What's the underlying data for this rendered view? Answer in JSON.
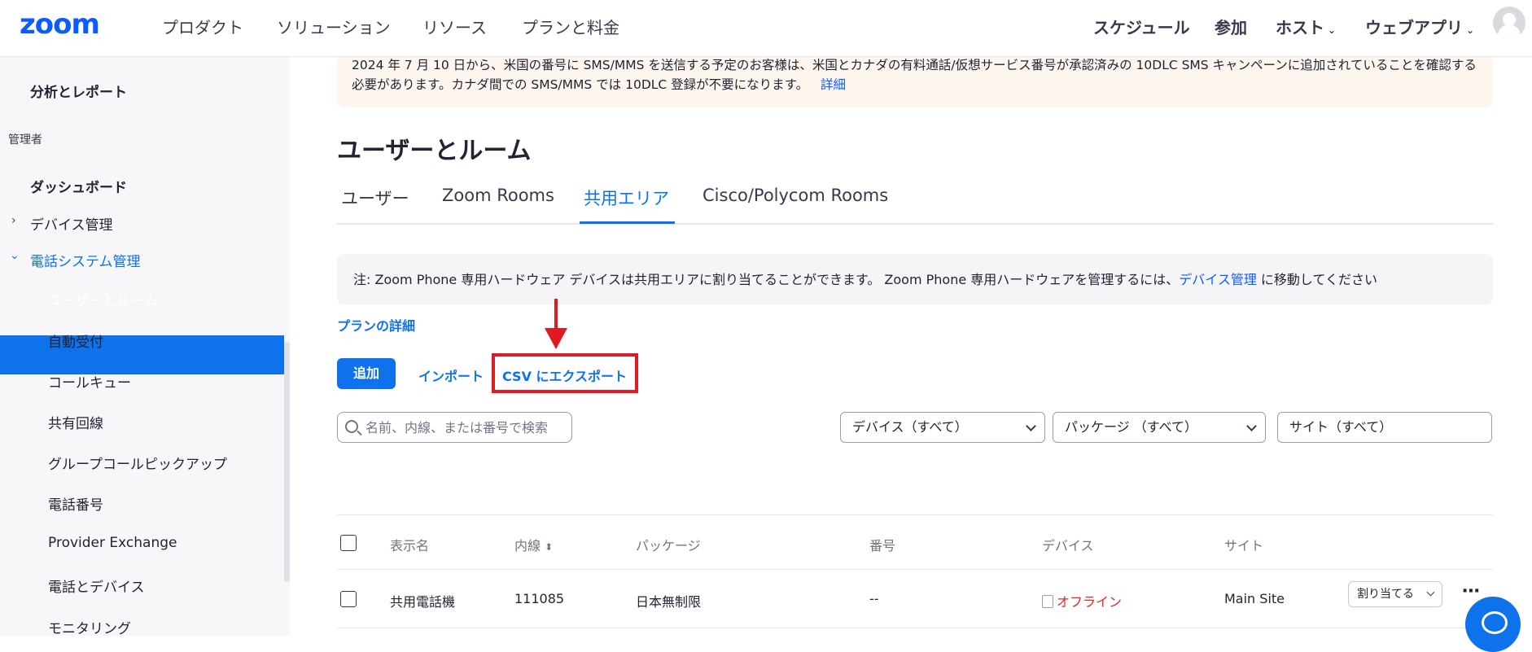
{
  "header": {
    "logo": "zoom",
    "nav": [
      "プロダクト",
      "ソリューション",
      "リソース",
      "プランと料金"
    ],
    "right_nav": [
      "スケジュール",
      "参加",
      "ホスト",
      "ウェブアプリ"
    ]
  },
  "sidebar": {
    "items": [
      {
        "label": "分析とレポート"
      },
      {
        "label": "管理者"
      },
      {
        "label": "ダッシュボード"
      },
      {
        "label": "デバイス管理",
        "chevron": "›"
      },
      {
        "label": "電話システム管理",
        "chevron": "⌄"
      },
      {
        "label": "ユーザーとルーム"
      },
      {
        "label": "自動受付"
      },
      {
        "label": "コールキュー"
      },
      {
        "label": "共有回線"
      },
      {
        "label": "グループコールピックアップ"
      },
      {
        "label": "電話番号"
      },
      {
        "label": "Provider Exchange"
      },
      {
        "label": "電話とデバイス"
      },
      {
        "label": "モニタリング"
      }
    ]
  },
  "banner": {
    "text": "2024 年 7 月 10 日から、米国の番号に SMS/MMS を送信する予定のお客様は、米国とカナダの有料通話/仮想サービス番号が承認済みの 10DLC SMS キャンペーンに追加されていることを確認する必要があります。カナダ間での SMS/MMS では 10DLC 登録が不要になります。",
    "link": "詳細"
  },
  "page_title": "ユーザーとルーム",
  "tabs": [
    {
      "label": "ユーザー"
    },
    {
      "label": "Zoom Rooms"
    },
    {
      "label": "共用エリア",
      "active": true
    },
    {
      "label": "Cisco/Polycom Rooms"
    }
  ],
  "note": {
    "text": "注: Zoom Phone 専用ハードウェア デバイスは共用エリアに割り当てることができます。 Zoom Phone 専用ハードウェアを管理するには、",
    "link": "デバイス管理",
    "suffix": " に移動してください"
  },
  "plan_link": "プランの詳細",
  "actions": {
    "add": "追加",
    "import": "インポート",
    "export": "CSV にエクスポート"
  },
  "search": {
    "placeholder": "名前、内線、または番号で検索"
  },
  "filters": {
    "device": "デバイス（すべて）",
    "package": "パッケージ （すべて）",
    "site": "サイト（すべて）"
  },
  "table": {
    "headers": [
      "表示名",
      "内線",
      "パッケージ",
      "番号",
      "デバイス",
      "サイト"
    ],
    "rows": [
      {
        "name": "共用電話機",
        "extension": "111085",
        "package": "日本無制限",
        "number": "--",
        "device": "オフライン",
        "site": "Main Site",
        "action": "割り当てる"
      }
    ]
  },
  "colors": {
    "accent": "#0e72ed",
    "highlight": "#e01a22",
    "offline": "#e02828"
  }
}
